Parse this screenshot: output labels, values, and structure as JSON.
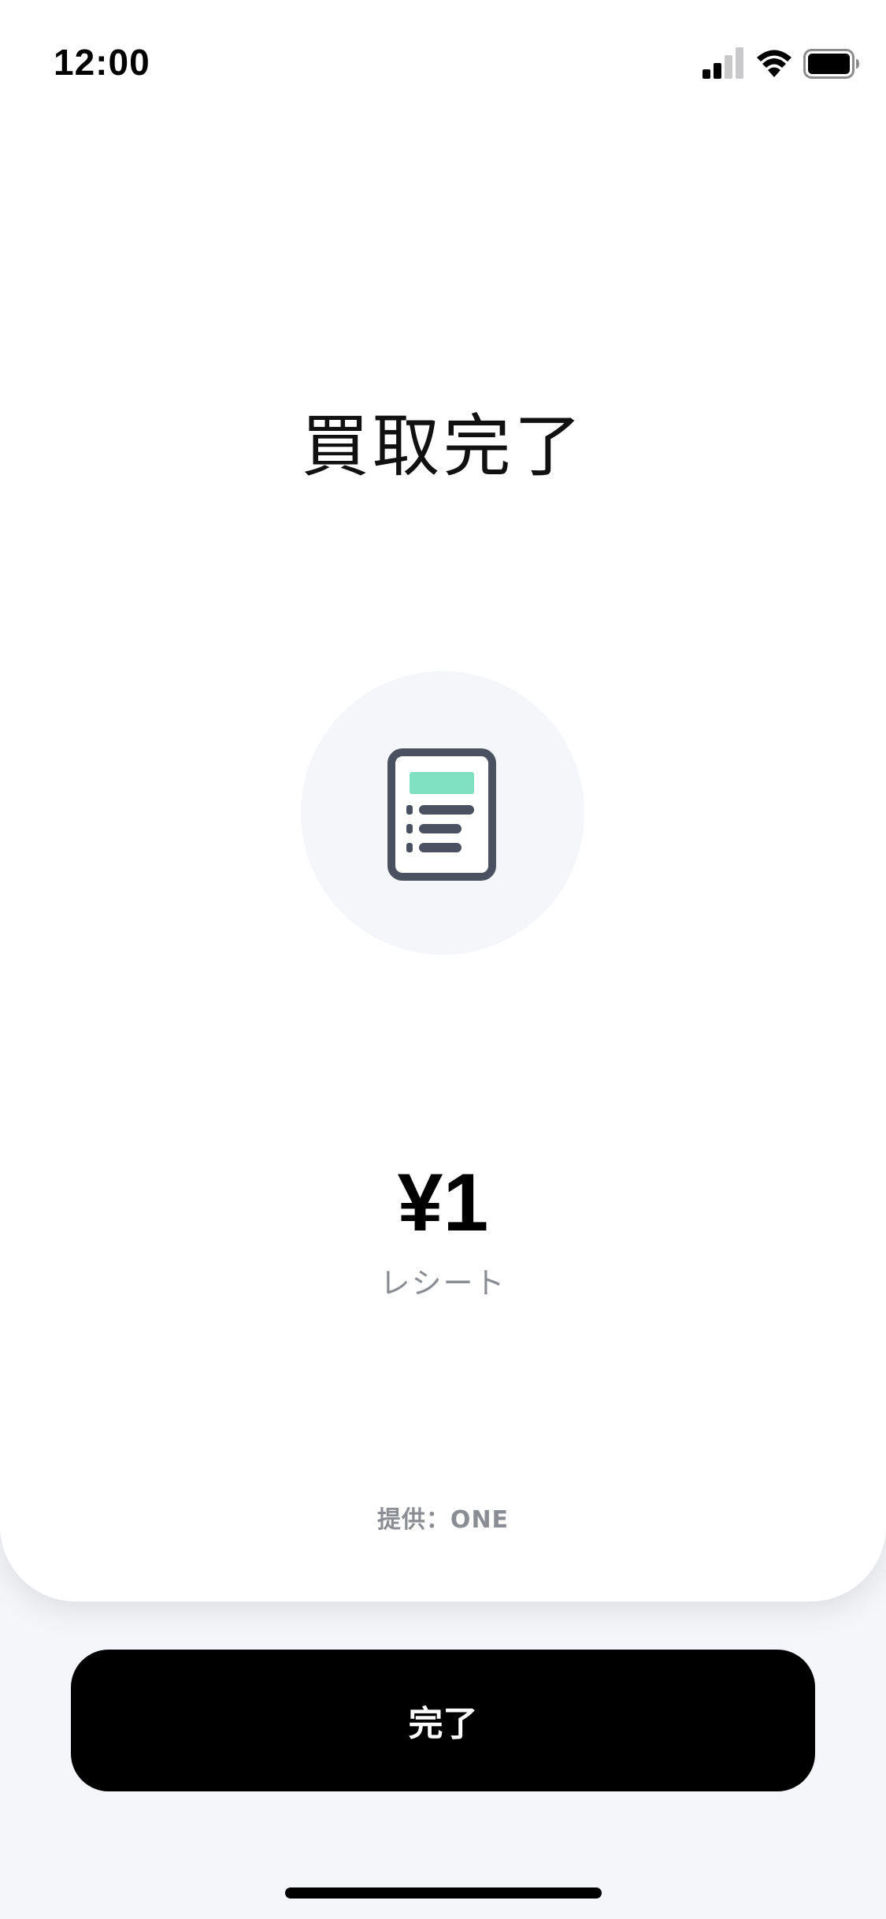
{
  "status_bar": {
    "time": "12:00",
    "signal_icon": "cellular-signal-icon",
    "wifi_icon": "wifi-icon",
    "battery_icon": "battery-icon"
  },
  "main": {
    "title": "買取完了",
    "item_icon": "receipt-icon",
    "amount": "¥1",
    "item_label": "レシート",
    "provider": "提供：ONE"
  },
  "actions": {
    "done_label": "完了"
  },
  "colors": {
    "accent": "#7fe0c2",
    "icon_dark": "#4a5160",
    "muted_text": "#8a8d94",
    "button_bg": "#000000",
    "page_bg": "#f4f6f9"
  }
}
